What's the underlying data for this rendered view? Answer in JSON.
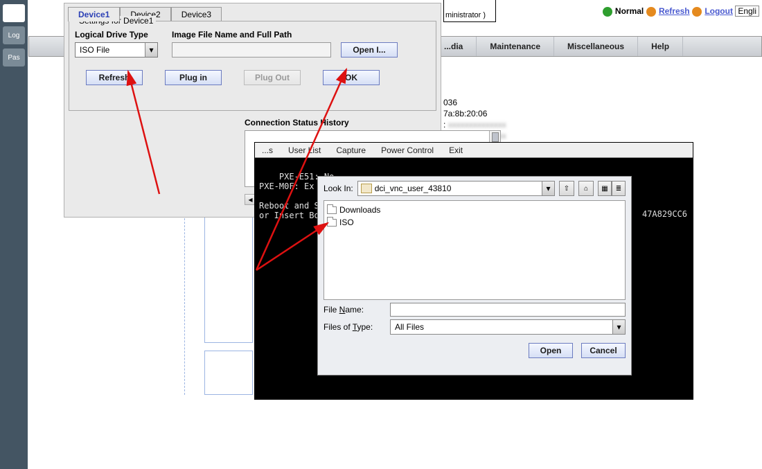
{
  "leftbar": {
    "items": [
      "",
      "Log",
      "Pas"
    ]
  },
  "header": {
    "normal": "Normal",
    "refresh": "Refresh",
    "logout": "Logout",
    "lang": "Engli",
    "admin_frag": "ministrator )"
  },
  "menubar": {
    "items": [
      "...dia",
      "Maintenance",
      "Miscellaneous",
      "Help"
    ]
  },
  "info": {
    "line1": "036",
    "line2": "7a:8b:20:06",
    "line3": ":",
    "line4": ":"
  },
  "device_panel": {
    "tabs": [
      "Device1",
      "Device2",
      "Device3"
    ],
    "group_title": "Settings for Device1",
    "drive_label": "Logical Drive Type",
    "drive_value": "ISO File",
    "path_label": "Image File Name and Full Path",
    "btn_open": "Open I...",
    "btn_refresh": "Refresh",
    "btn_plugin": "Plug in",
    "btn_plugout": "Plug Out",
    "btn_ok": "OK",
    "history_title": "Connection Status History"
  },
  "console": {
    "menus_stub": "...s",
    "menus": [
      "User List",
      "Capture",
      "Power Control",
      "Exit"
    ],
    "lines": "PXE-E51: No\nPXE-M0F: Ex\n\nReboot and S\nor Insert Bo",
    "hex": "47A829CC6"
  },
  "file_dialog": {
    "lookin_label": "Look In:",
    "lookin_value": "dci_vnc_user_43810",
    "folders": [
      "Downloads",
      "ISO"
    ],
    "filename_label": "File Name:",
    "filetype_label": "Files of Type:",
    "filetype_value": "All Files",
    "btn_open": "Open",
    "btn_cancel": "Cancel"
  }
}
